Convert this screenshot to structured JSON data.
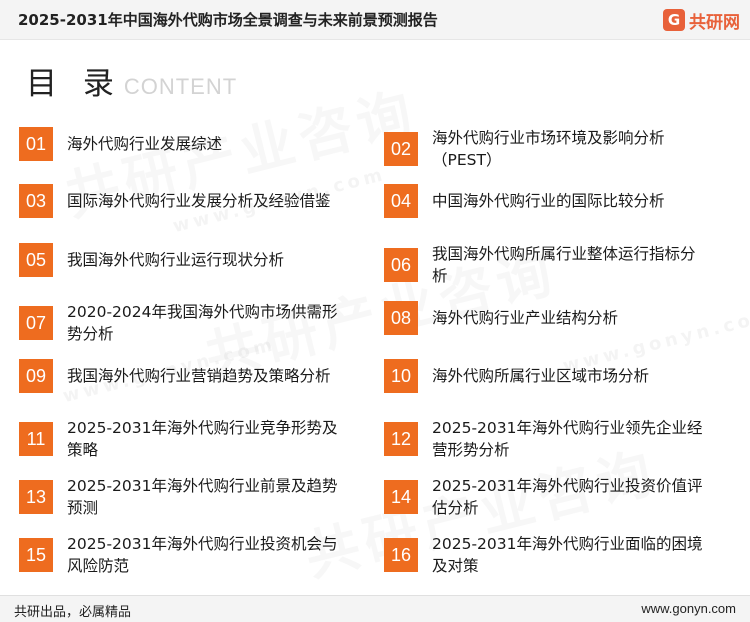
{
  "header": {
    "title": "2025-2031年中国海外代购市场全景调查与未来前景预测报告",
    "brand_mark": "G",
    "brand_name": "共研网"
  },
  "toc": {
    "title": "目 录",
    "subtitle": "CONTENT",
    "items": [
      {
        "num": "01",
        "label": "海外代购行业发展综述"
      },
      {
        "num": "02",
        "label": "海外代购行业市场环境及影响分析（PEST）"
      },
      {
        "num": "03",
        "label": "国际海外代购行业发展分析及经验借鉴"
      },
      {
        "num": "04",
        "label": "中国海外代购行业的国际比较分析"
      },
      {
        "num": "05",
        "label": "我国海外代购行业运行现状分析"
      },
      {
        "num": "06",
        "label": "我国海外代购所属行业整体运行指标分析"
      },
      {
        "num": "07",
        "label": "2020-2024年我国海外代购市场供需形势分析"
      },
      {
        "num": "08",
        "label": "海外代购行业产业结构分析"
      },
      {
        "num": "09",
        "label": "我国海外代购行业营销趋势及策略分析"
      },
      {
        "num": "10",
        "label": "海外代购所属行业区域市场分析"
      },
      {
        "num": "11",
        "label": "2025-2031年海外代购行业竞争形势及策略"
      },
      {
        "num": "12",
        "label": "2025-2031年海外代购行业领先企业经营形势分析"
      },
      {
        "num": "13",
        "label": "2025-2031年海外代购行业前景及趋势预测"
      },
      {
        "num": "14",
        "label": "2025-2031年海外代购行业投资价值评估分析"
      },
      {
        "num": "15",
        "label": "2025-2031年海外代购行业投资机会与风险防范"
      },
      {
        "num": "16",
        "label": "2025-2031年海外代购行业面临的困境及对策"
      }
    ]
  },
  "watermark": {
    "text": "共研产业咨询",
    "url": "www.gonyn.com"
  },
  "footer": {
    "slogan": "共研出品，必属精品",
    "website": "www.gonyn.com"
  },
  "colors": {
    "accent": "#ee6c1f",
    "brand": "#e8613a"
  }
}
